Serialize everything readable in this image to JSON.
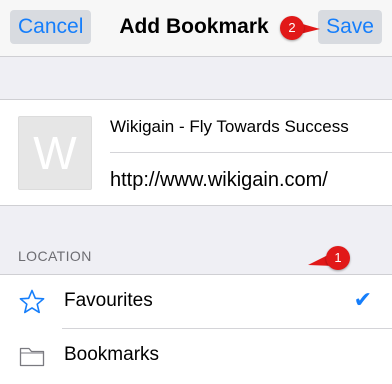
{
  "navbar": {
    "cancel_label": "Cancel",
    "title": "Add Bookmark",
    "save_label": "Save"
  },
  "bookmark": {
    "thumbnail_letter": "W",
    "title_value": "Wikigain - Fly Towards Success",
    "url_value": "http://www.wikigain.com/"
  },
  "location": {
    "header": "LOCATION",
    "items": [
      {
        "label": "Favourites",
        "icon": "star-icon",
        "selected": true
      },
      {
        "label": "Bookmarks",
        "icon": "folder-icon",
        "selected": false
      }
    ],
    "check_glyph": "✔"
  },
  "callouts": [
    {
      "number": "1"
    },
    {
      "number": "2"
    }
  ],
  "colors": {
    "accent": "#157efb",
    "callout": "#e11919"
  }
}
